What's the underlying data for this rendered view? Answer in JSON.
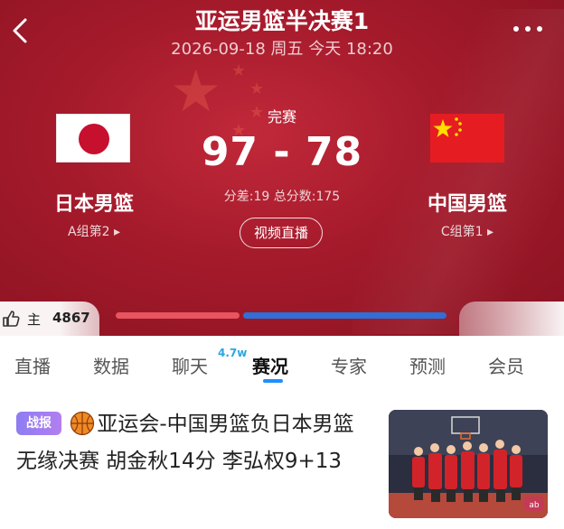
{
  "header": {
    "title": "亚运男篮半决赛1",
    "datetime": "2026-09-18 周五 今天 18:20",
    "status": "完赛",
    "score": "97 - 78",
    "score_stats": "分差:19 总分数:175",
    "video_button": "视频直播",
    "colors": {
      "background": "#a41a2b",
      "home_bar": "#e8545f",
      "away_bar": "#2f6fd7"
    }
  },
  "home_team": {
    "name": "日本男篮",
    "rank": "A组第2 ▸",
    "flag_icon": "japan-flag-icon"
  },
  "away_team": {
    "name": "中国男篮",
    "rank": "C组第1 ▸",
    "flag_icon": "china-flag-icon"
  },
  "support": {
    "label": "主",
    "count": "4867",
    "home_share": 0.38
  },
  "tabs": [
    {
      "label": "直播"
    },
    {
      "label": "数据"
    },
    {
      "label": "聊天",
      "badge": "4.7w"
    },
    {
      "label": "赛况",
      "active": true
    },
    {
      "label": "专家"
    },
    {
      "label": "预测"
    },
    {
      "label": "会员"
    }
  ],
  "news": {
    "tag": "战报",
    "title": "亚运会-中国男篮负日本男篮无缘决赛 胡金秋14分 李弘权9+13",
    "icon": "basketball-icon",
    "thumb_badge": "ab"
  }
}
